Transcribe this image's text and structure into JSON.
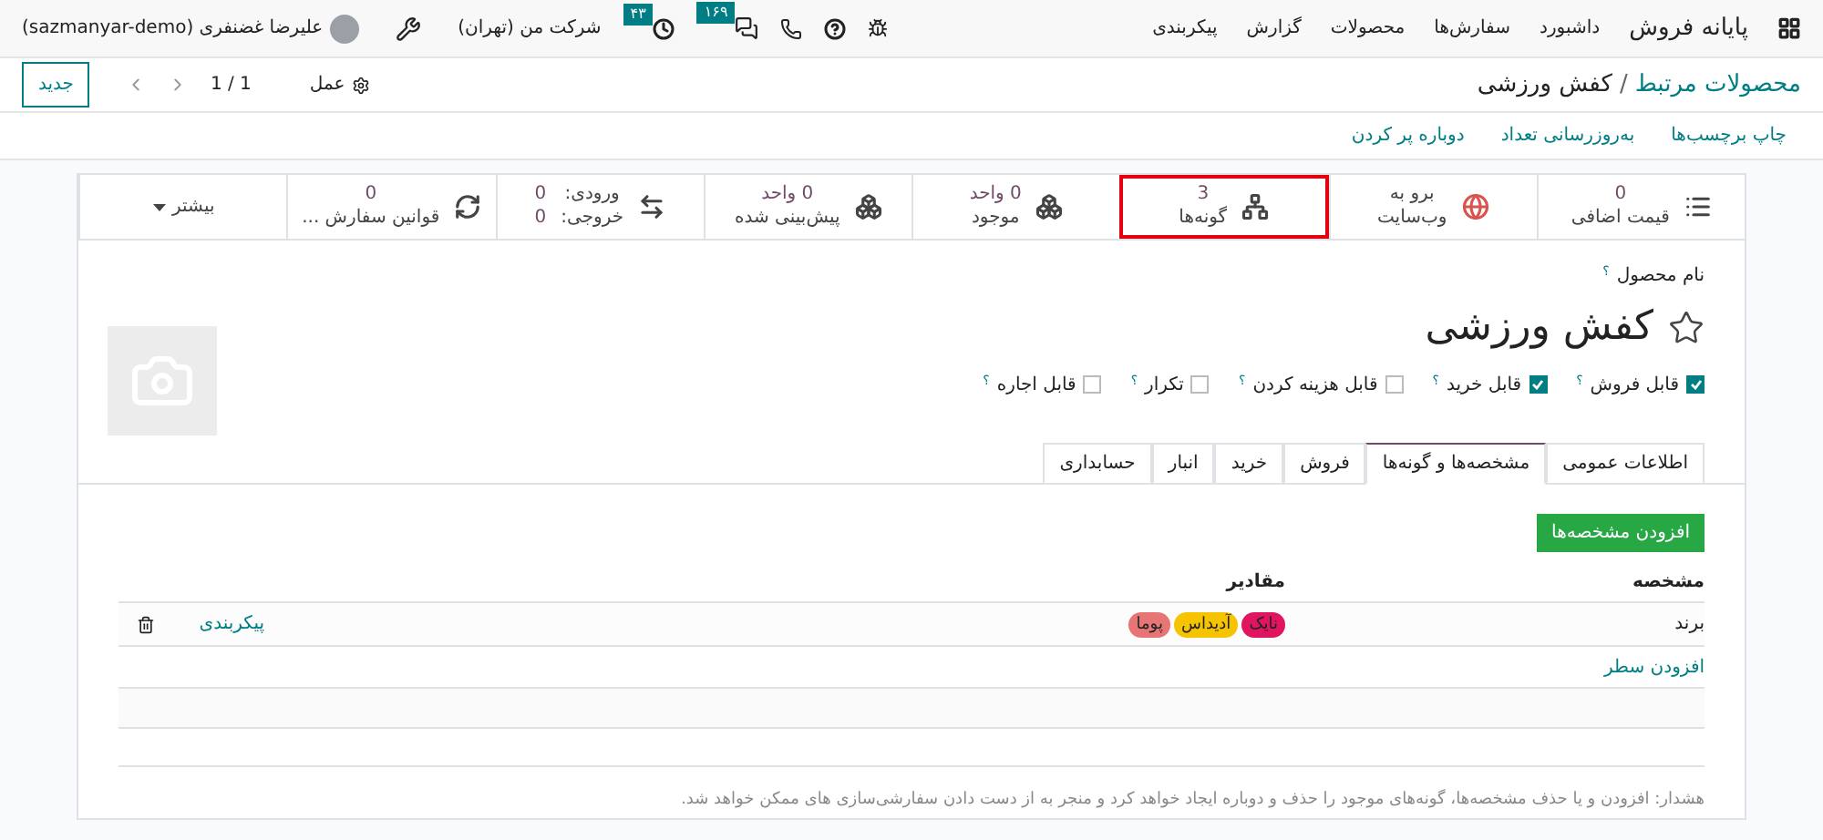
{
  "app_nav": {
    "app_name": "پایانه فروش",
    "menu": [
      "داشبورد",
      "سفارش‌ها",
      "محصولات",
      "گزارش",
      "پیکربندی"
    ]
  },
  "systray": {
    "messages_badge": "۱۶۹",
    "activity_badge": "۴۳",
    "company": "شرکت من (تهران)",
    "user": "علیرضا غضنفری (sazmanyar-demo)"
  },
  "breadcrumb": {
    "parent": "محصولات مرتبط",
    "separator": "/",
    "current": "کفش ورزشی"
  },
  "control": {
    "action": "عمل",
    "pager": "1 / 1",
    "new_button": "جدید"
  },
  "header_actions": [
    "چاپ برچسب‌ها",
    "به‌روزرسانی تعداد",
    "دوباره پر کردن"
  ],
  "smart_buttons": [
    {
      "kind": "stat",
      "value": "0",
      "label": "قیمت اضافی",
      "highlighted": false
    },
    {
      "kind": "website",
      "lines": [
        "برو به",
        "وب‌سایت"
      ],
      "highlighted": false
    },
    {
      "kind": "stat",
      "value": "3",
      "label": "گونه‌ها",
      "highlighted": true
    },
    {
      "kind": "stat",
      "value": "0 واحد",
      "label": "موجود",
      "highlighted": false
    },
    {
      "kind": "stat",
      "value": "0 واحد",
      "label": "پیش‌بینی شده",
      "highlighted": false
    },
    {
      "kind": "inout",
      "in_label": "ورودی:",
      "in_value": "0",
      "out_label": "خروجی:",
      "out_value": "0",
      "highlighted": false
    },
    {
      "kind": "stat",
      "value": "0",
      "label": "قوانین سفارش ...",
      "highlighted": false
    },
    {
      "kind": "more",
      "label": "بیشتر",
      "highlighted": false
    }
  ],
  "product": {
    "name_label": "نام محصول",
    "tooltip": "؟",
    "name": "کفش ورزشی",
    "favorite": false
  },
  "options": [
    {
      "label": "قابل فروش",
      "checked": true,
      "tooltip": "؟"
    },
    {
      "label": "قابل خرید",
      "checked": true,
      "tooltip": "؟"
    },
    {
      "label": "قابل هزینه کردن",
      "checked": false,
      "tooltip": "؟"
    },
    {
      "label": "تکرار",
      "checked": false,
      "tooltip": "؟"
    },
    {
      "label": "قابل اجاره",
      "checked": false,
      "tooltip": "؟"
    }
  ],
  "tabs": [
    {
      "label": "اطلاعات عمومی",
      "selected": false
    },
    {
      "label": "مشخصه‌ها و گونه‌ها",
      "selected": true
    },
    {
      "label": "فروش",
      "selected": false
    },
    {
      "label": "خرید",
      "selected": false
    },
    {
      "label": "انبار",
      "selected": false
    },
    {
      "label": "حسابداری",
      "selected": false
    }
  ],
  "add_attribute_button": "افزودن مشخصه‌ها",
  "table": {
    "columns": [
      "مشخصه",
      "مقادیر"
    ],
    "rows": [
      {
        "attribute": "برند",
        "values": [
          {
            "label": "نایک",
            "color": "#e0145f"
          },
          {
            "label": "آدیداس",
            "color": "#f5c300"
          },
          {
            "label": "پوما",
            "color": "#e87575"
          }
        ],
        "configure": "پیکربندی"
      }
    ],
    "add_line": "افزودن سطر"
  },
  "warning": "هشدار: افزودن و یا حذف مشخصه‌ها، گونه‌های موجود را حذف و دوباره ایجاد خواهد کرد و منجر به از دست دادن سفارشی‌سازی های ممکن خواهد شد."
}
